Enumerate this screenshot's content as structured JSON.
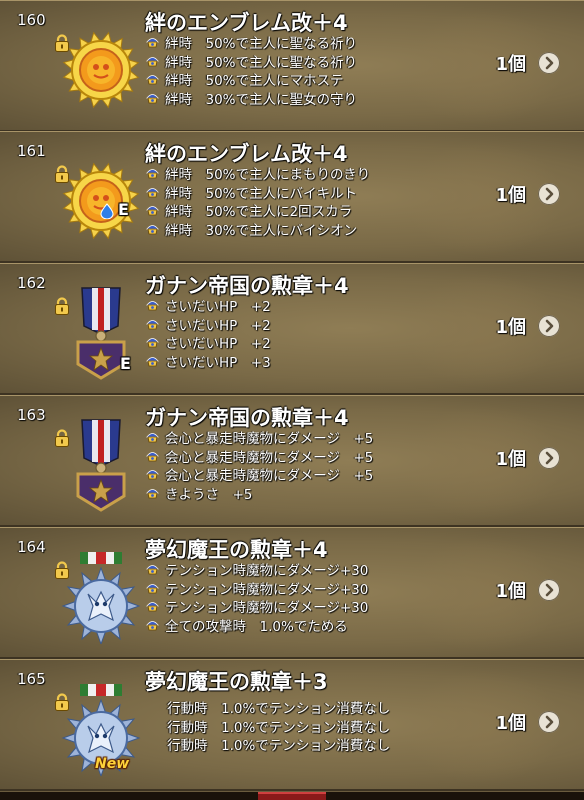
{
  "items": [
    {
      "number": "160",
      "name": "絆のエンブレム改＋4",
      "badge": "sun-emblem",
      "equipped": false,
      "is_new": false,
      "effects": [
        "絆時　50%で主人に聖なる祈り",
        "絆時　50%で主人に聖なる祈り",
        "絆時　50%で主人にマホステ",
        "絆時　30%で主人に聖女の守り"
      ],
      "effect_icons": true,
      "count": "1個"
    },
    {
      "number": "161",
      "name": "絆のエンブレム改＋4",
      "badge": "sun-emblem",
      "equipped": true,
      "equip_mark": "E",
      "is_new": false,
      "effects": [
        "絆時　50%で主人にまもりのきり",
        "絆時　50%で主人にバイキルト",
        "絆時　50%で主人に2回スカラ",
        "絆時　30%で主人にバイシオン"
      ],
      "effect_icons": true,
      "count": "1個"
    },
    {
      "number": "162",
      "name": "ガナン帝国の勲章＋4",
      "badge": "ganan-medal",
      "equipped": true,
      "equip_mark": "E",
      "is_new": false,
      "effects": [
        "さいだいHP　+2",
        "さいだいHP　+2",
        "さいだいHP　+2",
        "さいだいHP　+3"
      ],
      "effect_icons": true,
      "count": "1個"
    },
    {
      "number": "163",
      "name": "ガナン帝国の勲章＋4",
      "badge": "ganan-medal",
      "equipped": false,
      "is_new": false,
      "effects": [
        "会心と暴走時魔物にダメージ　+5",
        "会心と暴走時魔物にダメージ　+5",
        "会心と暴走時魔物にダメージ　+5",
        "きようさ　+5"
      ],
      "effect_icons": true,
      "count": "1個"
    },
    {
      "number": "164",
      "name": "夢幻魔王の勲章＋4",
      "badge": "demon-medal",
      "equipped": false,
      "is_new": false,
      "effects": [
        "テンション時魔物にダメージ+30",
        "テンション時魔物にダメージ+30",
        "テンション時魔物にダメージ+30",
        "全ての攻撃時　1.0%でためる"
      ],
      "effect_icons": true,
      "count": "1個"
    },
    {
      "number": "165",
      "name": "夢幻魔王の勲章＋3",
      "badge": "demon-medal",
      "equipped": false,
      "is_new": true,
      "new_label": "New",
      "effects": [
        "行動時　1.0%でテンション消費なし",
        "行動時　1.0%でテンション消費なし",
        "行動時　1.0%でテンション消費なし"
      ],
      "effect_icons": false,
      "count": "1個"
    }
  ],
  "colors": {
    "panel": "#7a6a47",
    "text": "#ffffff",
    "arrow_button": "#e8e2d4",
    "new_label": "#ffd23a"
  },
  "icons": {
    "lock": "padlock-icon",
    "effect": "bond-crest-icon",
    "next": "chevron-right-icon"
  }
}
